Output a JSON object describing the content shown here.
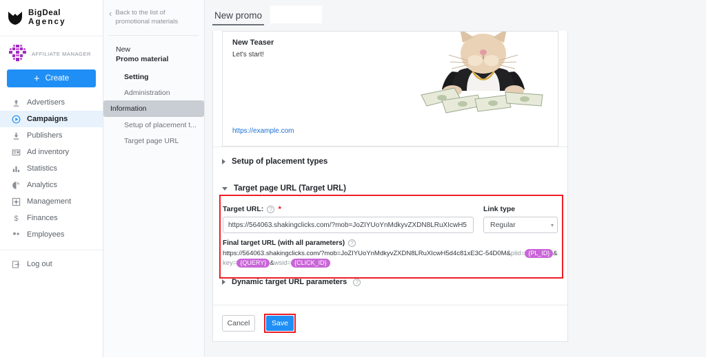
{
  "brand": {
    "line1": "BigDeal",
    "line2": "Agency",
    "logo_icon": "shield-logo-icon"
  },
  "account": {
    "role_label": "AFFILIATE MANAGER",
    "avatar_icon": "identicon-avatar"
  },
  "create_button": {
    "label": "Create",
    "icon": "plus-icon"
  },
  "sidebar": {
    "items": [
      {
        "label": "Advertisers",
        "icon": "upload-arrow-icon",
        "active": false
      },
      {
        "label": "Campaigns",
        "icon": "play-circle-icon",
        "active": true
      },
      {
        "label": "Publishers",
        "icon": "download-arrow-icon",
        "active": false
      },
      {
        "label": "Ad inventory",
        "icon": "ad-card-icon",
        "active": false
      },
      {
        "label": "Statistics",
        "icon": "bar-chart-icon",
        "active": false
      },
      {
        "label": "Analytics",
        "icon": "pie-chart-icon",
        "active": false
      },
      {
        "label": "Management",
        "icon": "settings-box-icon",
        "active": false
      },
      {
        "label": "Finances",
        "icon": "dollar-icon",
        "active": false
      },
      {
        "label": "Employees",
        "icon": "people-icon",
        "active": false
      }
    ],
    "logout": {
      "label": "Log out",
      "icon": "logout-icon"
    }
  },
  "subnav": {
    "back": {
      "label": "Back to the list of promotional materials",
      "icon": "chevron-left-icon"
    },
    "heading_line1": "New",
    "heading_line2": "Promo material",
    "items": [
      {
        "label": "Setting",
        "style": "bold",
        "selected": false
      },
      {
        "label": "Administration",
        "style": "normal",
        "selected": false
      },
      {
        "label": "Information",
        "style": "normal",
        "selected": true
      },
      {
        "label": "Setup of placement t...",
        "style": "normal",
        "selected": false
      },
      {
        "label": "Target page URL",
        "style": "normal",
        "selected": false
      }
    ]
  },
  "tabs": [
    {
      "label": "New promo",
      "active": true
    }
  ],
  "preview": {
    "title": "New Teaser",
    "subtitle": "Let's start!",
    "link": "https://example.com",
    "image_icon": "cat-in-suit-with-money-photo"
  },
  "sections": {
    "placement_types": {
      "label": "Setup of placement types",
      "expanded": false,
      "caret_icon": "caret-right-icon"
    },
    "target_url": {
      "label": "Target page URL (Target URL)",
      "expanded": true,
      "caret_icon": "caret-down-icon",
      "target_url_label": "Target URL:",
      "target_url_value": "https://564063.shakingclicks.com/?mob=JoZIYUoYnMdkyvZXDN8LRuXIcwH5",
      "required_mark": "*",
      "help_icon": "help-circle-icon",
      "link_type_label": "Link type",
      "link_type_value": "Regular",
      "link_type_caret": "select-caret-icon",
      "final_label": "Final target URL (with all parameters)",
      "final_url_prefix": "https://564063.shakingclicks.com/?mob=JoZIYUoYnMdkyvZXDN8LRuXIcwH5d4c81xE3C-54D0M&",
      "final_parts": [
        {
          "text": "plid=",
          "type": "dim"
        },
        {
          "text": "{PL_ID}",
          "type": "chip"
        },
        {
          "text": "&",
          "type": "plain"
        },
        {
          "text": "key=",
          "type": "dim"
        },
        {
          "text": "{QUERY}",
          "type": "chip"
        },
        {
          "text": "&",
          "type": "plain"
        },
        {
          "text": "wsid=",
          "type": "dim"
        },
        {
          "text": "{CLICK_ID}",
          "type": "chip"
        }
      ]
    },
    "dynamic_params": {
      "label": "Dynamic target URL parameters",
      "expanded": false,
      "caret_icon": "caret-right-icon",
      "help_icon": "help-circle-icon"
    }
  },
  "footer": {
    "cancel_label": "Cancel",
    "save_label": "Save"
  },
  "colors": {
    "accent_blue": "#1f8ff5",
    "highlight_red": "#ee1c25",
    "chip_purple": "#c965d8",
    "active_nav": "#e8f2fd"
  }
}
